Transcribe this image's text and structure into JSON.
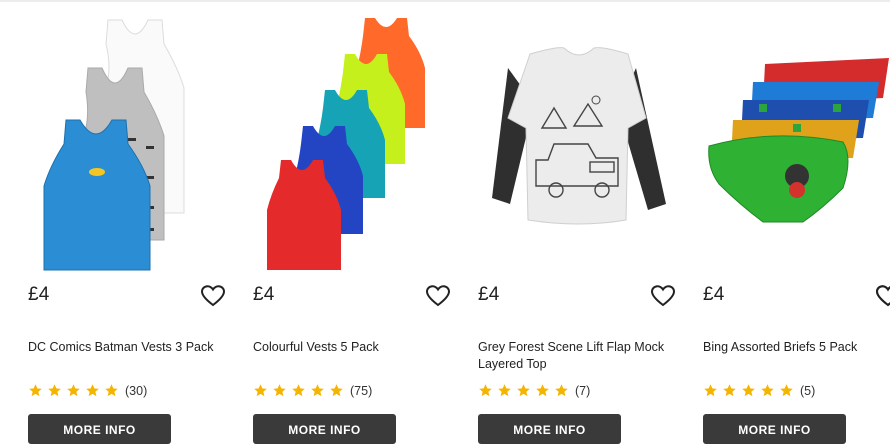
{
  "products": [
    {
      "price": "£4",
      "title": "DC Comics Batman Vests 3 Pack",
      "rating_count": "(30)",
      "rating": 5,
      "button": "MORE INFO"
    },
    {
      "price": "£4",
      "title": "Colourful Vests 5 Pack",
      "rating_count": "(75)",
      "rating": 5,
      "button": "MORE INFO"
    },
    {
      "price": "£4",
      "title": "Grey Forest Scene Lift Flap Mock Layered Top",
      "rating_count": "(7)",
      "rating": 5,
      "button": "MORE INFO"
    },
    {
      "price": "£4",
      "title": "Bing Assorted Briefs 5 Pack",
      "rating_count": "(5)",
      "rating": 5,
      "button": "MORE INFO"
    }
  ],
  "icons": {
    "wishlist": "heart-outline-icon",
    "rating": "star-icon"
  },
  "colors": {
    "star": "#f5b400",
    "button_bg": "#3a3a3a",
    "text": "#222222"
  }
}
